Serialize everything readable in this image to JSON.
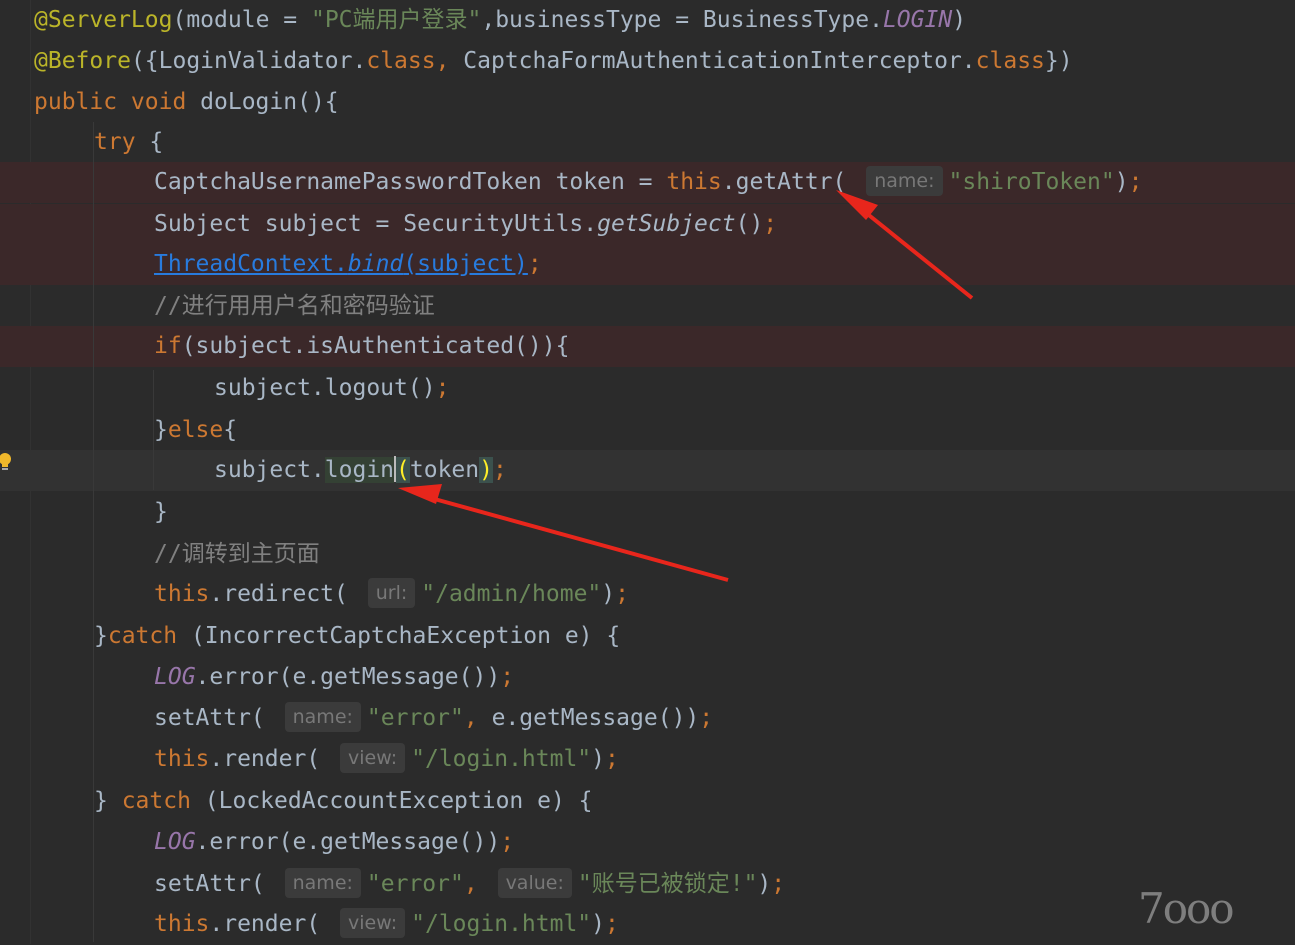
{
  "editor": {
    "lines": [
      {
        "segments": [
          [
            "t-ann",
            "@ServerLog"
          ],
          [
            "t-punct",
            "(module = "
          ],
          [
            "t-str",
            "\"PC端用户登录\""
          ],
          [
            "t-punct",
            ",businessType = BusinessType."
          ],
          [
            "t-static",
            "LOGIN"
          ],
          [
            "t-punct",
            ")"
          ]
        ]
      },
      {
        "segments": [
          [
            "t-ann",
            "@Before"
          ],
          [
            "t-punct",
            "({LoginValidator."
          ],
          [
            "t-kw",
            "class"
          ],
          [
            "t-semi",
            ", "
          ],
          [
            "t-punct",
            "CaptchaFormAuthenticationInterceptor."
          ],
          [
            "t-kw",
            "class"
          ],
          [
            "t-punct",
            "})"
          ]
        ]
      },
      {
        "segments": [
          [
            "t-kw",
            "public void "
          ],
          [
            "t-fn",
            "doLogin"
          ],
          [
            "t-punct",
            "(){"
          ]
        ]
      },
      {
        "segments": [
          [
            "t-kw",
            "try "
          ],
          [
            "t-punct",
            "{"
          ]
        ]
      },
      {
        "segments": [
          [
            "t-punct",
            "CaptchaUsernamePasswordToken token = "
          ],
          [
            "t-kw",
            "this"
          ],
          [
            "t-punct",
            ".getAttr( "
          ],
          [
            "hint",
            "name:"
          ],
          [
            "t-str",
            "\"shiroToken\""
          ],
          [
            "t-punct",
            ")"
          ],
          [
            "t-semi",
            ";"
          ]
        ]
      },
      {
        "segments": [
          [
            "t-punct",
            "Subject subject = SecurityUtils."
          ],
          [
            "t-it",
            "getSubject"
          ],
          [
            "t-punct",
            "()"
          ],
          [
            "t-semi",
            ";"
          ]
        ]
      },
      {
        "segments": [
          [
            "t-link",
            "ThreadContext."
          ],
          [
            "t-link-it",
            "bind"
          ],
          [
            "t-link",
            "(subject)"
          ],
          [
            "t-semi",
            ";"
          ]
        ]
      },
      {
        "segments": [
          [
            "t-cmt",
            "//进行用用户名和密码验证"
          ]
        ]
      },
      {
        "segments": [
          [
            "t-kw",
            "if"
          ],
          [
            "t-punct",
            "(subject.isAuthenticated()){"
          ]
        ]
      },
      {
        "segments": [
          [
            "t-punct",
            "subject.logout()"
          ],
          [
            "t-semi",
            ";"
          ]
        ]
      },
      {
        "segments": [
          [
            "t-punct",
            "}"
          ],
          [
            "t-kw",
            "else"
          ],
          [
            "t-punct",
            "{"
          ]
        ]
      },
      {
        "segments": [
          [
            "t-punct",
            "subject."
          ],
          [
            "t-hl",
            "login"
          ],
          [
            "caret",
            ""
          ],
          [
            "t-paren-hl",
            "("
          ],
          [
            "t-punct",
            "token"
          ],
          [
            "t-paren-hl",
            ")"
          ],
          [
            "t-semi",
            ";"
          ]
        ]
      },
      {
        "segments": [
          [
            "t-punct",
            "}"
          ]
        ]
      },
      {
        "segments": [
          [
            "t-cmt",
            "//调转到主页面"
          ]
        ]
      },
      {
        "segments": [
          [
            "t-kw",
            "this"
          ],
          [
            "t-punct",
            ".redirect( "
          ],
          [
            "hint",
            "url:"
          ],
          [
            "t-str",
            "\"/admin/home\""
          ],
          [
            "t-punct",
            ")"
          ],
          [
            "t-semi",
            ";"
          ]
        ]
      },
      {
        "segments": [
          [
            "t-punct",
            "}"
          ],
          [
            "t-kw",
            "catch "
          ],
          [
            "t-punct",
            "(IncorrectCaptchaException e) {"
          ]
        ]
      },
      {
        "segments": [
          [
            "t-static",
            "LOG"
          ],
          [
            "t-punct",
            ".error(e.getMessage())"
          ],
          [
            "t-semi",
            ";"
          ]
        ]
      },
      {
        "segments": [
          [
            "t-punct",
            "setAttr( "
          ],
          [
            "hint",
            "name:"
          ],
          [
            "t-str",
            "\"error\""
          ],
          [
            "t-semi",
            ", "
          ],
          [
            "t-punct",
            "e.getMessage())"
          ],
          [
            "t-semi",
            ";"
          ]
        ]
      },
      {
        "segments": [
          [
            "t-kw",
            "this"
          ],
          [
            "t-punct",
            ".render( "
          ],
          [
            "hint",
            "view:"
          ],
          [
            "t-str",
            "\"/login.html\""
          ],
          [
            "t-punct",
            ")"
          ],
          [
            "t-semi",
            ";"
          ]
        ]
      },
      {
        "segments": [
          [
            "t-punct",
            "} "
          ],
          [
            "t-kw",
            "catch "
          ],
          [
            "t-punct",
            "(LockedAccountException e) {"
          ]
        ]
      },
      {
        "segments": [
          [
            "t-static",
            "LOG"
          ],
          [
            "t-punct",
            ".error(e.getMessage())"
          ],
          [
            "t-semi",
            ";"
          ]
        ]
      },
      {
        "segments": [
          [
            "t-punct",
            "setAttr( "
          ],
          [
            "hint",
            "name:"
          ],
          [
            "t-str",
            "\"error\""
          ],
          [
            "t-semi",
            ", "
          ],
          [
            "hint",
            "value:"
          ],
          [
            "t-str",
            "\"账号已被锁定!\""
          ],
          [
            "t-punct",
            ")"
          ],
          [
            "t-semi",
            ";"
          ]
        ]
      },
      {
        "segments": [
          [
            "t-kw",
            "this"
          ],
          [
            "t-punct",
            ".render( "
          ],
          [
            "hint",
            "view:"
          ],
          [
            "t-str",
            "\"/login.html\""
          ],
          [
            "t-punct",
            ")"
          ],
          [
            "t-semi",
            ";"
          ]
        ]
      }
    ]
  },
  "watermark": {
    "text": "7ooo"
  },
  "colors": {
    "arrow": "#e8261c",
    "error_line": "#3b2829",
    "background": "#2b2b2b"
  }
}
